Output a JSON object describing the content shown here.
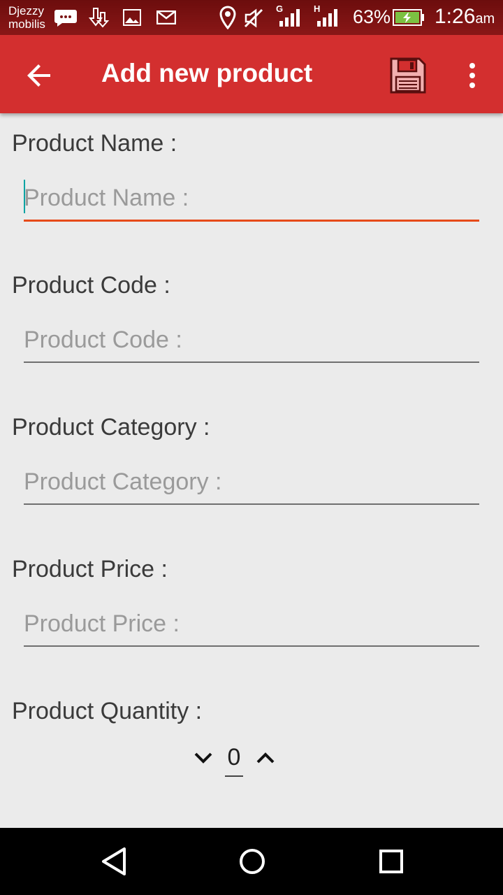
{
  "status_bar": {
    "carrier_line1": "Djezzy",
    "carrier_line2": "mobilis",
    "network1_label": "G",
    "network2_label": "H",
    "battery": "63%",
    "time": "1:26",
    "time_suffix": "am",
    "icons": [
      "chat-bubble-icon",
      "download-icon",
      "image-icon",
      "mail-icon",
      "location-icon",
      "mute-icon",
      "signal-icon",
      "signal-icon",
      "battery-charging-icon"
    ]
  },
  "app_bar": {
    "title": "Add new product",
    "color": "#d32f2f",
    "icons": [
      "back-arrow-icon",
      "save-floppy-icon",
      "more-vert-icon"
    ]
  },
  "form": {
    "name": {
      "label": "Product Name :",
      "placeholder": "Product Name :",
      "value": ""
    },
    "code": {
      "label": "Product Code :",
      "placeholder": "Product Code :",
      "value": ""
    },
    "category": {
      "label": "Product Category :",
      "placeholder": "Product Category :",
      "value": ""
    },
    "price": {
      "label": "Product Price :",
      "placeholder": "Product Price :",
      "value": ""
    },
    "quantity": {
      "label": "Product Quantity :",
      "value": "0"
    }
  },
  "nav_bar": {
    "icons": [
      "back-triangle-icon",
      "home-circle-icon",
      "recents-square-icon"
    ]
  }
}
